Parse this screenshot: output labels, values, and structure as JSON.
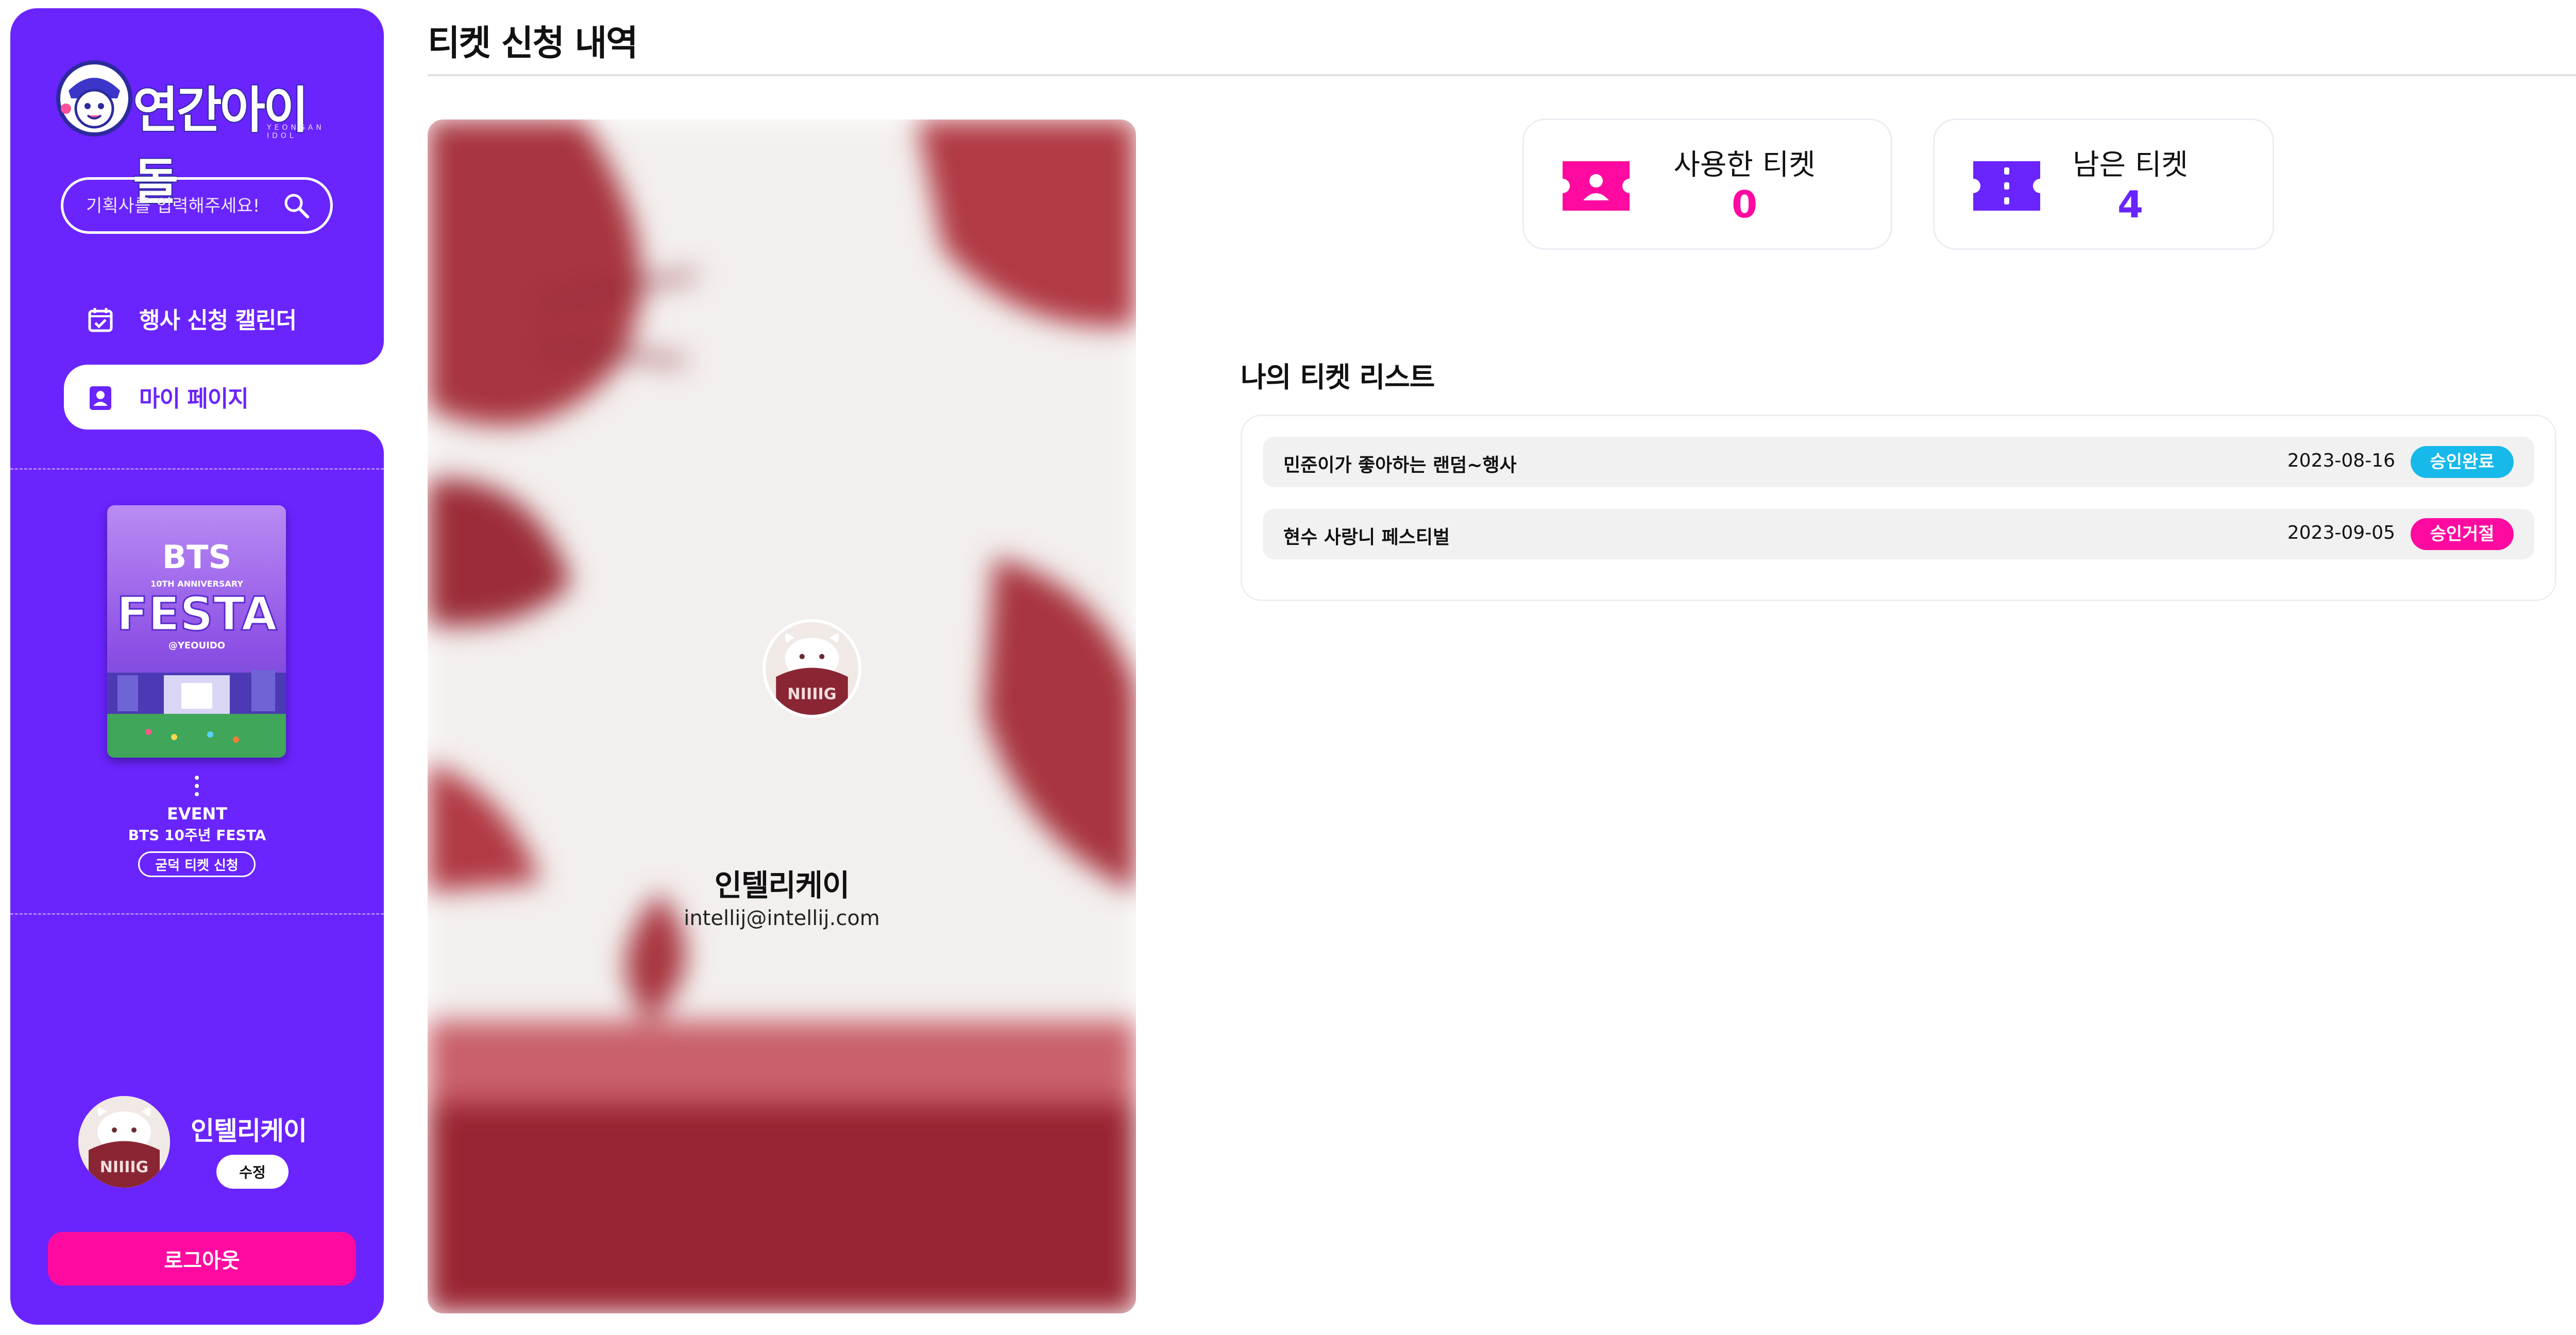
{
  "app": {
    "logo_text": "연간아이돌",
    "logo_sub": "YEONGAN IDOL"
  },
  "sidebar": {
    "search_placeholder": "기획사를 입력해주세요!",
    "nav": [
      {
        "label": "행사 신청 캘린더",
        "icon": "calendar-check-icon"
      },
      {
        "label": "마이 페이지",
        "icon": "user-badge-icon",
        "active": true
      }
    ],
    "event": {
      "poster_text": "BTS 10TH ANNIVERSARY FESTA @YEOUIDO",
      "type": "EVENT",
      "name": "BTS 10주년 FESTA",
      "button": "굳덕 티켓 신청"
    },
    "profile": {
      "name": "인텔리케이",
      "edit_label": "수정"
    },
    "logout_label": "로그아웃"
  },
  "main": {
    "title": "티켓 신청 내역",
    "card": {
      "name": "인텔리케이",
      "email": "intellij@intellij.com"
    },
    "stats": {
      "used": {
        "label": "사용한 티켓",
        "value": "0"
      },
      "remaining": {
        "label": "남은 티켓",
        "value": "4"
      }
    },
    "list_title": "나의 티켓 리스트",
    "tickets": [
      {
        "name": "민준이가 좋아하는 랜덤~행사",
        "date": "2023-08-16",
        "status": "승인완료"
      },
      {
        "name": "현수 사랑니 페스티벌",
        "date": "2023-09-05",
        "status": "승인거절"
      }
    ]
  },
  "colors": {
    "brand_purple": "#6a24fe",
    "accent_pink": "#ff0aa0",
    "approved_blue": "#16b9ea",
    "card_maroon": "#8a2634"
  }
}
